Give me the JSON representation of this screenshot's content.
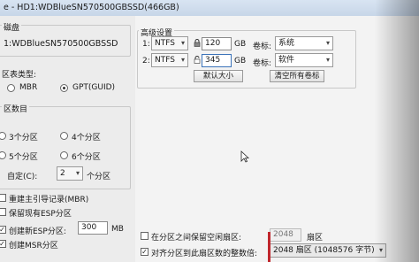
{
  "window": {
    "title": "e - HD1:WDBlueSN570500GBSSD(466GB)"
  },
  "left": {
    "disk_group_label": "磁盘",
    "disk_name": "1:WDBlueSN570500GBSSD",
    "partition_type_label": "区表类型:",
    "mbr_label": "MBR",
    "gpt_label": "GPT(GUID)",
    "count_label": "区数目",
    "opt3": "3个分区",
    "opt4": "4个分区",
    "opt5": "5个分区",
    "opt6": "6个分区",
    "custom_label": "自定(C):",
    "custom_value": "2",
    "custom_suffix": "个分区",
    "rebuild_mbr": "重建主引导记录(MBR)",
    "keep_esp": "保留现有ESP分区",
    "create_esp": "创建新ESP分区:",
    "esp_size": "300",
    "esp_unit": "MB",
    "create_msr": "创建MSR分区"
  },
  "right": {
    "advanced_label": "高级设置",
    "rows": [
      {
        "num": "1:",
        "fs": "NTFS",
        "size": "120",
        "unit": "GB",
        "vol_label": "卷标:",
        "vol_value": "系统"
      },
      {
        "num": "2:",
        "fs": "NTFS",
        "size": "345",
        "unit": "GB",
        "vol_label": "卷标:",
        "vol_value": "软件"
      }
    ],
    "default_size_button": "默认大小",
    "clear_labels_button": "清空所有卷标",
    "free_space_label": "在分区之间保留空闲扇区:",
    "free_space_value": "2048",
    "free_space_unit": "扇区",
    "align_label": "对齐分区到此扇区数的整数倍:",
    "align_value": "2048 扇区 (1048576 字节)"
  }
}
